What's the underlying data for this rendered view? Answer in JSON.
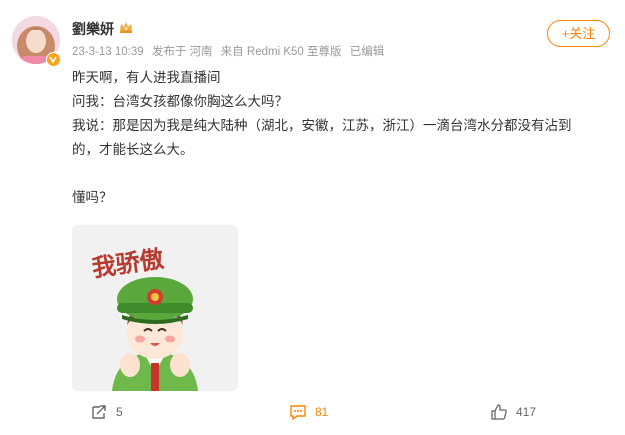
{
  "post": {
    "user_name": "劉樂妍",
    "meta": {
      "time": "23-3-13 10:39",
      "location": "发布于 河南",
      "source": "来自 Redmi K50 至尊版",
      "edited": "已编辑"
    },
    "follow_label": "+关注",
    "content_lines": [
      "昨天啊，有人进我直播间",
      "问我：台湾女孩都像你胸这么大吗？",
      "我说：那是因为我是纯大陆种（湖北，安徽，江苏，浙江）一滴台湾水分都没有沾到",
      "的，才能长这么大。",
      "",
      "懂吗？"
    ],
    "image": {
      "caption_text": "我骄傲"
    },
    "actions": {
      "repost_count": "5",
      "comment_count": "81",
      "like_count": "417"
    }
  },
  "colors": {
    "accent": "#ff8200",
    "meta_text": "#999999",
    "body_text": "#333333",
    "verify_badge": "#f7a51c",
    "image_bg": "#f1f1f1"
  },
  "icons": {
    "avatar": "avatar",
    "verify": "verified-badge-icon",
    "crown": "crown-icon",
    "repost": "repost-icon",
    "comment": "comment-icon",
    "like": "like-icon"
  }
}
